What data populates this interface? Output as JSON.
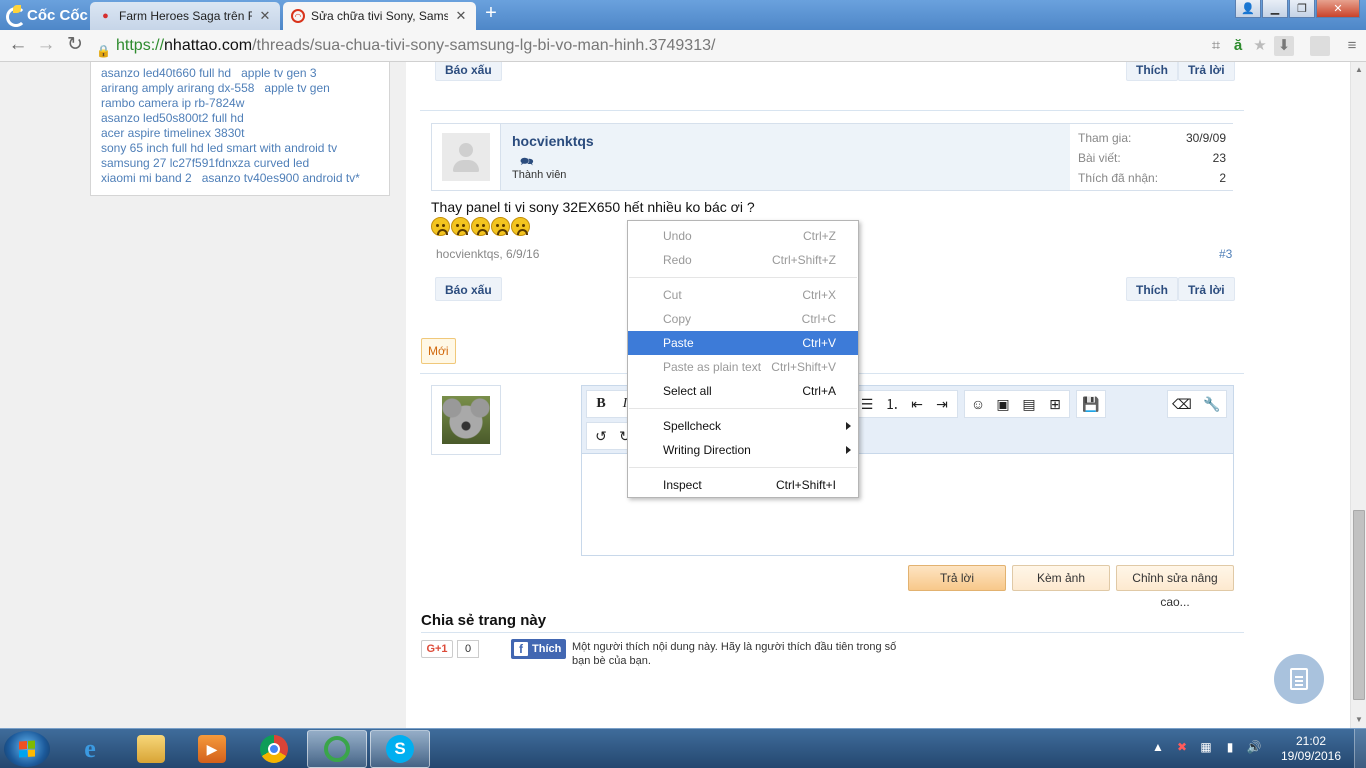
{
  "browser": {
    "brand": "Cốc Cốc",
    "tabs": [
      {
        "title": "Farm Heroes Saga trên Fac",
        "icon": "strawberry-icon",
        "active": false
      },
      {
        "title": "Sửa chữa tivi Sony, Samsu",
        "icon": "nhattao-icon",
        "active": true
      }
    ],
    "url": {
      "scheme": "https://",
      "host": "nhattao.com",
      "path": "/threads/sua-chua-tivi-sony-samsung-lg-bi-vo-man-hinh.3749313/"
    },
    "accent": "#4e87c8"
  },
  "sidebar": {
    "lines": [
      [
        "asanzo led40t660 full hd",
        "apple tv gen 3"
      ],
      [
        "arirang amply arirang dx-558",
        "apple tv gen"
      ],
      [
        "rambo camera ip rb-7824w"
      ],
      [
        "asanzo led50s800t2 full hd"
      ],
      [
        "acer aspire timelinex 3830t"
      ],
      [
        "sony 65 inch full hd led smart with android tv"
      ],
      [
        "samsung 27 lc27f591fdnxza curved led"
      ],
      [
        "xiaomi mi band 2",
        "asanzo tv40es900 android tv*"
      ]
    ],
    "link_color": "#4f7fb8"
  },
  "prev_post": {
    "report": "Báo xấu",
    "like": "Thích",
    "reply": "Trả lời"
  },
  "post": {
    "username": "hocvienktqs",
    "role": "Thành viên",
    "stats": [
      {
        "label": "Tham gia:",
        "value": "30/9/09"
      },
      {
        "label": "Bài viết:",
        "value": "23"
      },
      {
        "label": "Thích đã nhận:",
        "value": "2"
      }
    ],
    "message": "Thay panel ti vi sony 32EX650 hết nhiều ko bác ơi ?",
    "emoji_count": 5,
    "meta": "hocvienktqs, 6/9/16",
    "permalink": "#3",
    "report": "Báo xấu",
    "like": "Thích",
    "reply": "Trả lời"
  },
  "new_badge": "Mới",
  "quick_reply": {
    "submit": "Trả lời",
    "attach": "Kèm ảnh",
    "advanced": "Chỉnh sửa nâng cao..."
  },
  "share": {
    "title": "Chia sẻ trang này",
    "gplus_label": "G+1",
    "gplus_count": "0",
    "fb_label": "Thích",
    "fb_text": "Một người thích nội dung này. Hãy là người thích đầu tiên trong số bạn bè của bạn."
  },
  "context_menu": {
    "items": [
      {
        "label": "Undo",
        "shortcut": "Ctrl+Z",
        "disabled": true
      },
      {
        "label": "Redo",
        "shortcut": "Ctrl+Shift+Z",
        "disabled": true
      },
      {
        "sep": true
      },
      {
        "label": "Cut",
        "shortcut": "Ctrl+X",
        "disabled": true
      },
      {
        "label": "Copy",
        "shortcut": "Ctrl+C",
        "disabled": true
      },
      {
        "label": "Paste",
        "shortcut": "Ctrl+V",
        "highlighted": true
      },
      {
        "label": "Paste as plain text",
        "shortcut": "Ctrl+Shift+V",
        "disabled": true
      },
      {
        "label": "Select all",
        "shortcut": "Ctrl+A"
      },
      {
        "sep": true
      },
      {
        "label": "Spellcheck",
        "submenu": true
      },
      {
        "label": "Writing Direction",
        "submenu": true
      },
      {
        "sep": true
      },
      {
        "label": "Inspect",
        "shortcut": "Ctrl+Shift+I"
      }
    ],
    "highlight_color": "#3d7bd8"
  },
  "taskbar": {
    "apps": [
      "ie-icon",
      "file-explorer-icon",
      "media-player-icon",
      "chrome-icon",
      "coccoc-icon",
      "skype-icon"
    ],
    "time": "21:02",
    "date": "19/09/2016"
  }
}
